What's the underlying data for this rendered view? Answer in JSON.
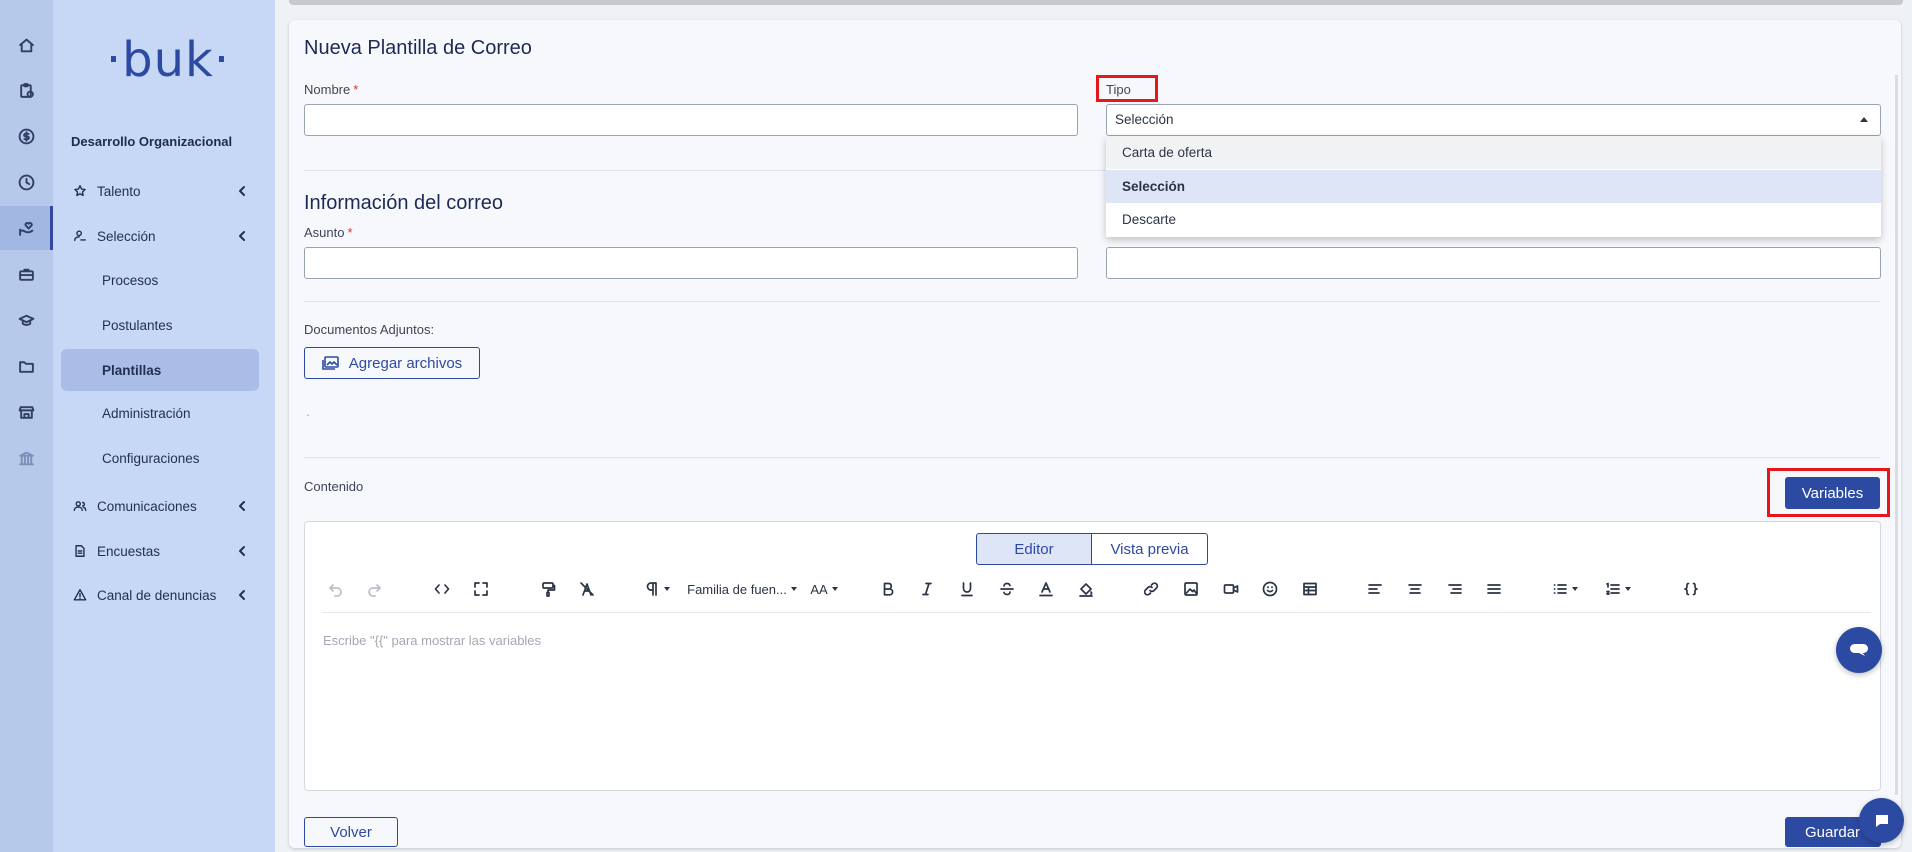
{
  "rail": {
    "items": [
      {
        "name": "home-icon"
      },
      {
        "name": "clipboard-clock-icon"
      },
      {
        "name": "dollar-circle-icon"
      },
      {
        "name": "clock-icon"
      },
      {
        "name": "hand-heart-icon"
      },
      {
        "name": "briefcase-icon"
      },
      {
        "name": "graduation-cap-icon"
      },
      {
        "name": "folder-icon"
      },
      {
        "name": "store-icon"
      },
      {
        "name": "bank-icon"
      }
    ]
  },
  "sidebar": {
    "logo": "·buk·",
    "org_title": "Desarrollo Organizacional",
    "items": [
      {
        "label": "Talento",
        "icon": "star-icon"
      },
      {
        "label": "Selección",
        "icon": "user-hand-icon"
      },
      {
        "label": "Comunicaciones",
        "icon": "users-icon"
      },
      {
        "label": "Encuestas",
        "icon": "document-icon"
      },
      {
        "label": "Canal de denuncias",
        "icon": "warning-icon"
      }
    ],
    "sub_items": [
      {
        "label": "Procesos"
      },
      {
        "label": "Postulantes"
      },
      {
        "label": "Plantillas"
      },
      {
        "label": "Administración"
      },
      {
        "label": "Configuraciones"
      }
    ]
  },
  "form": {
    "title": "Nueva Plantilla de Correo",
    "nombre_label": "Nombre",
    "required_mark": "*",
    "nombre_value": "",
    "tipo_label": "Tipo",
    "tipo_value": "Selección",
    "tipo_options": [
      "Carta de oferta",
      "Selección",
      "Descarte"
    ],
    "info_title": "Información del correo",
    "asunto_label": "Asunto",
    "asunto_value": "",
    "second_value": "",
    "attachments_label": "Documentos Adjuntos:",
    "add_files_label": "Agregar archivos",
    "dot_text": "·",
    "content_label": "Contenido",
    "variables_label": "Variables"
  },
  "editor": {
    "tab_editor": "Editor",
    "tab_preview": "Vista previa",
    "font_family_label": "Familia de fuen...",
    "font_size_label": "AA",
    "placeholder": "Escribe \"{{\" para mostrar las variables"
  },
  "footer": {
    "back_label": "Volver",
    "save_label": "Guardar"
  },
  "colors": {
    "brand": "#2d4aa3",
    "highlight": "#e5161c",
    "sidebar_bg": "#c7d8f7",
    "rail_bg": "#b7c9ea"
  }
}
